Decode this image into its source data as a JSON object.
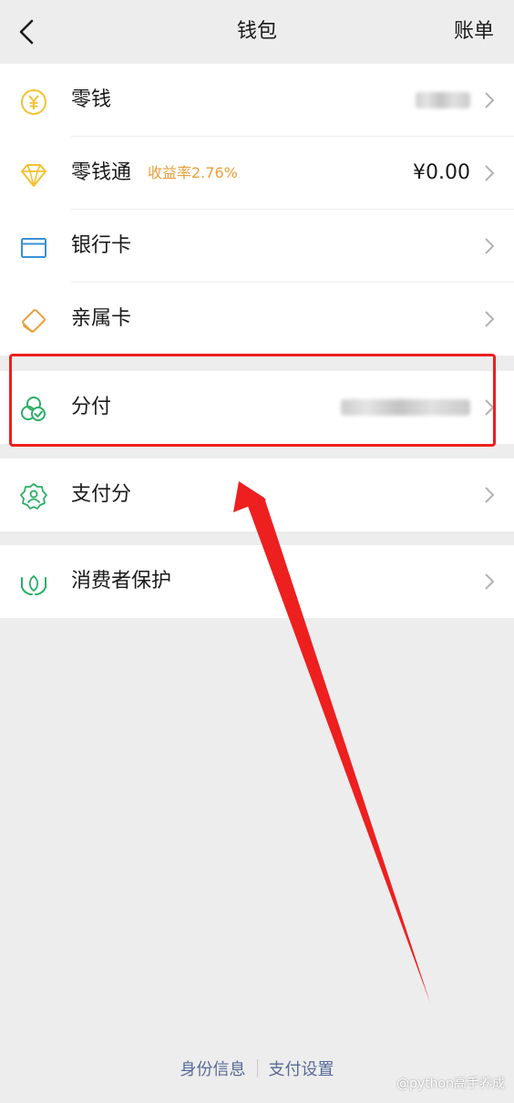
{
  "nav": {
    "title": "钱包",
    "bill": "账单"
  },
  "wallet_items": [
    {
      "label": "零钱",
      "icon": "yen-coin-icon",
      "value": ""
    },
    {
      "label": "零钱通",
      "icon": "diamond-icon",
      "badge": "收益率2.76%",
      "value": "¥0.00"
    },
    {
      "label": "银行卡",
      "icon": "bank-card-icon"
    },
    {
      "label": "亲属卡",
      "icon": "family-card-icon"
    }
  ],
  "fenfu": {
    "label": "分付",
    "icon": "fenfu-circles-icon"
  },
  "pay_score": {
    "label": "支付分",
    "icon": "pay-score-badge-icon"
  },
  "consumer": {
    "label": "消费者保护",
    "icon": "protection-hands-icon"
  },
  "footer": {
    "identity": "身份信息",
    "pay_settings": "支付设置"
  },
  "watermark": "@python高手养成",
  "colors": {
    "background": "#ededed",
    "card": "#ffffff",
    "badge": "#e8a03c",
    "link": "#576b95",
    "highlight": "#ee1f1f",
    "icon_yellow": "#f2c230",
    "icon_blue": "#3a8fd6",
    "icon_orange": "#e8a03c",
    "icon_green": "#2aae67"
  }
}
